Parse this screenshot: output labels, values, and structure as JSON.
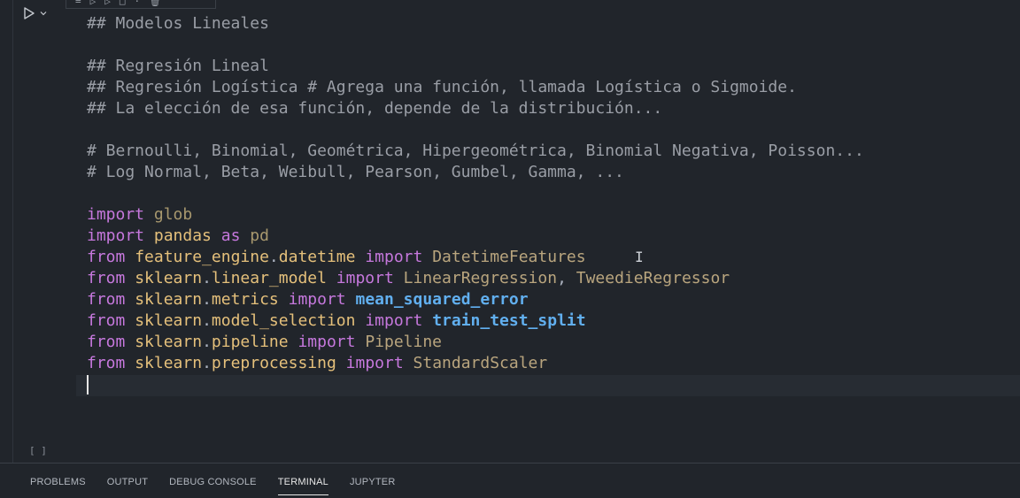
{
  "cell": {
    "run_icon": "play-icon",
    "run_menu_icon": "chevron-down-icon",
    "execution_count": "[ ]",
    "toolbar_icons": [
      "split-cell-icon",
      "execute-above-icon",
      "execute-below-icon",
      "collapse-icon",
      "more-icon",
      "delete-icon"
    ]
  },
  "code": {
    "lines": [
      [
        {
          "t": "## Modelos Lineales",
          "c": "comment"
        }
      ],
      [],
      [
        {
          "t": "## Regresión Lineal",
          "c": "comment"
        }
      ],
      [
        {
          "t": "## Regresión Logística # Agrega una función, llamada Logística o Sigmoide.",
          "c": "comment"
        }
      ],
      [
        {
          "t": "## La elección de esa función, depende de la distribución...",
          "c": "comment"
        }
      ],
      [],
      [
        {
          "t": "# Bernoulli, Binomial, Geométrica, Hipergeométrica, Binomial Negativa, Poisson...",
          "c": "comment"
        }
      ],
      [
        {
          "t": "# Log Normal, Beta, Weibull, Pearson, Gumbel, Gamma, ...",
          "c": "comment"
        }
      ],
      [],
      [
        {
          "t": "import",
          "c": "kw"
        },
        {
          "t": " ",
          "c": "plain"
        },
        {
          "t": "glob",
          "c": "mod-dim"
        }
      ],
      [
        {
          "t": "import",
          "c": "kw"
        },
        {
          "t": " ",
          "c": "plain"
        },
        {
          "t": "pandas",
          "c": "mod"
        },
        {
          "t": " ",
          "c": "plain"
        },
        {
          "t": "as",
          "c": "kw"
        },
        {
          "t": " ",
          "c": "plain"
        },
        {
          "t": "pd",
          "c": "mod-dim"
        }
      ],
      [
        {
          "t": "from",
          "c": "kw"
        },
        {
          "t": " ",
          "c": "plain"
        },
        {
          "t": "feature_engine",
          "c": "mod"
        },
        {
          "t": ".",
          "c": "plain"
        },
        {
          "t": "datetime",
          "c": "mod"
        },
        {
          "t": " ",
          "c": "plain"
        },
        {
          "t": "import",
          "c": "kw"
        },
        {
          "t": " ",
          "c": "plain"
        },
        {
          "t": "DatetimeFeatures",
          "c": "cls"
        }
      ],
      [
        {
          "t": "from",
          "c": "kw"
        },
        {
          "t": " ",
          "c": "plain"
        },
        {
          "t": "sklearn",
          "c": "mod"
        },
        {
          "t": ".",
          "c": "plain"
        },
        {
          "t": "linear_model",
          "c": "mod"
        },
        {
          "t": " ",
          "c": "plain"
        },
        {
          "t": "import",
          "c": "kw"
        },
        {
          "t": " ",
          "c": "plain"
        },
        {
          "t": "LinearRegression",
          "c": "cls"
        },
        {
          "t": ", ",
          "c": "plain"
        },
        {
          "t": "TweedieRegressor",
          "c": "cls"
        }
      ],
      [
        {
          "t": "from",
          "c": "kw"
        },
        {
          "t": " ",
          "c": "plain"
        },
        {
          "t": "sklearn",
          "c": "mod"
        },
        {
          "t": ".",
          "c": "plain"
        },
        {
          "t": "metrics",
          "c": "mod"
        },
        {
          "t": " ",
          "c": "plain"
        },
        {
          "t": "import",
          "c": "kw"
        },
        {
          "t": " ",
          "c": "plain"
        },
        {
          "t": "mean_squared_error",
          "c": "fn"
        }
      ],
      [
        {
          "t": "from",
          "c": "kw"
        },
        {
          "t": " ",
          "c": "plain"
        },
        {
          "t": "sklearn",
          "c": "mod"
        },
        {
          "t": ".",
          "c": "plain"
        },
        {
          "t": "model_selection",
          "c": "mod"
        },
        {
          "t": " ",
          "c": "plain"
        },
        {
          "t": "import",
          "c": "kw"
        },
        {
          "t": " ",
          "c": "plain"
        },
        {
          "t": "train_test_split",
          "c": "fn"
        }
      ],
      [
        {
          "t": "from",
          "c": "kw"
        },
        {
          "t": " ",
          "c": "plain"
        },
        {
          "t": "sklearn",
          "c": "mod"
        },
        {
          "t": ".",
          "c": "plain"
        },
        {
          "t": "pipeline",
          "c": "mod"
        },
        {
          "t": " ",
          "c": "plain"
        },
        {
          "t": "import",
          "c": "kw"
        },
        {
          "t": " ",
          "c": "plain"
        },
        {
          "t": "Pipeline",
          "c": "cls"
        }
      ],
      [
        {
          "t": "from",
          "c": "kw"
        },
        {
          "t": " ",
          "c": "plain"
        },
        {
          "t": "sklearn",
          "c": "mod"
        },
        {
          "t": ".",
          "c": "plain"
        },
        {
          "t": "preprocessing",
          "c": "mod"
        },
        {
          "t": " ",
          "c": "plain"
        },
        {
          "t": "import",
          "c": "kw"
        },
        {
          "t": " ",
          "c": "plain"
        },
        {
          "t": "StandardScaler",
          "c": "cls"
        }
      ]
    ]
  },
  "panel": {
    "tabs": [
      {
        "label": "PROBLEMS",
        "active": false
      },
      {
        "label": "OUTPUT",
        "active": false
      },
      {
        "label": "DEBUG CONSOLE",
        "active": false
      },
      {
        "label": "TERMINAL",
        "active": true
      },
      {
        "label": "JUPYTER",
        "active": false
      }
    ]
  },
  "colors": {
    "background": "#21252b",
    "comment": "#9a9ea6",
    "keyword": "#c678dd",
    "module": "#e5c07b",
    "function": "#61afef"
  }
}
